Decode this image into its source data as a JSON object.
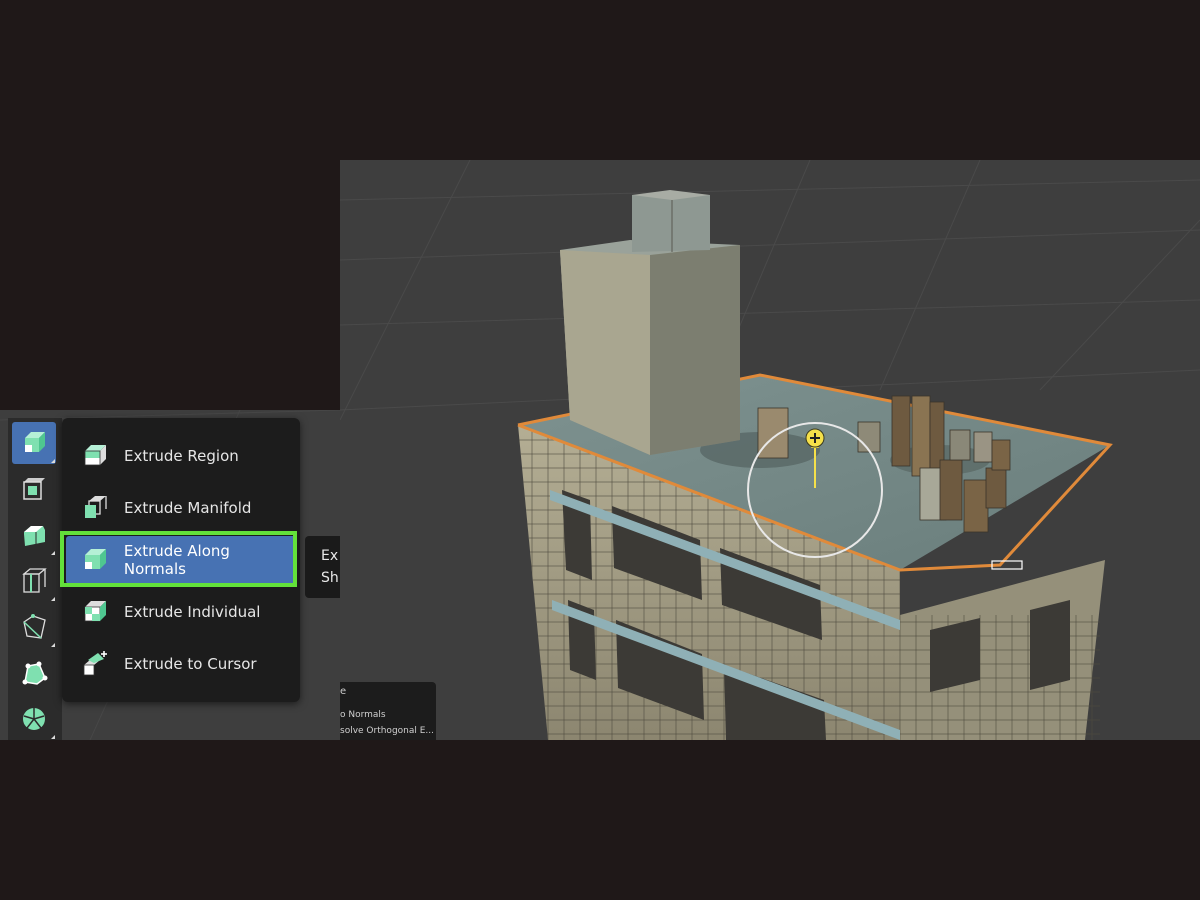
{
  "extrude_menu": {
    "items": [
      {
        "label": "Extrude Region",
        "icon": "extrude-region-icon"
      },
      {
        "label": "Extrude Manifold",
        "icon": "extrude-manifold-icon"
      },
      {
        "label": "Extrude Along Normals",
        "icon": "extrude-along-normals-icon",
        "highlighted": true
      },
      {
        "label": "Extrude Individual",
        "icon": "extrude-individual-icon"
      },
      {
        "label": "Extrude to Cursor",
        "icon": "extrude-to-cursor-icon"
      }
    ]
  },
  "toolbar": {
    "tools": [
      {
        "icon": "extrude-tool-icon",
        "active": true
      },
      {
        "icon": "inset-faces-icon"
      },
      {
        "icon": "bevel-icon"
      },
      {
        "icon": "loop-cut-icon"
      },
      {
        "icon": "knife-icon"
      },
      {
        "icon": "poly-build-icon"
      },
      {
        "icon": "spin-icon"
      }
    ]
  },
  "tooltip": {
    "line1": "Ex",
    "line2": "Sh"
  },
  "redo_panel": {
    "title": "e",
    "opt1": "o Normals",
    "opt2": "solve Orthogonal E..."
  },
  "colors": {
    "highlight_box": "#63e13a",
    "active_item": "#4772b3",
    "selection_edge": "#e08a3a",
    "gizmo": "#f5e04a",
    "tool_icon": "#7fe0b0"
  }
}
